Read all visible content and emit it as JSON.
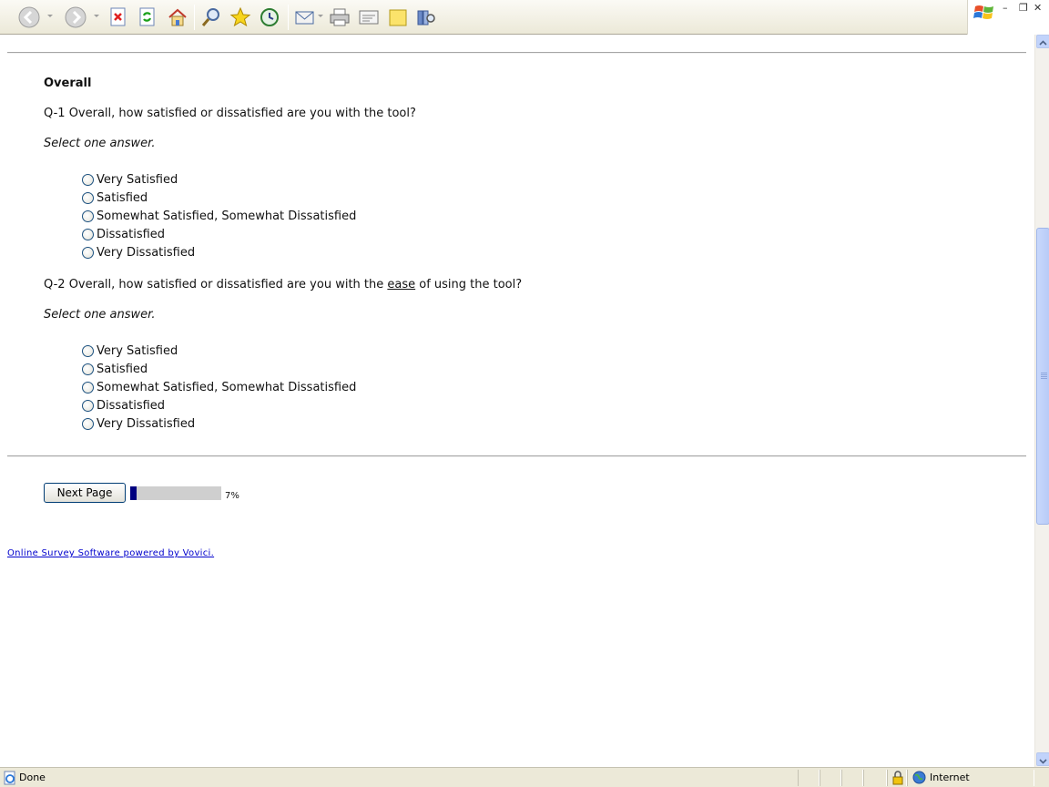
{
  "toolbar": {
    "icons": [
      "back-icon",
      "forward-icon",
      "stop-icon",
      "refresh-icon",
      "home-icon",
      "search-icon",
      "favorites-icon",
      "history-icon",
      "mail-icon",
      "print-icon",
      "edit-icon",
      "discuss-icon",
      "research-icon"
    ]
  },
  "survey": {
    "section_title": "Overall",
    "questions": [
      {
        "prompt_before": "Q-1 Overall, how satisfied or dissatisfied are you with the tool?",
        "instruction": "Select one answer.",
        "options": [
          "Very Satisfied",
          "Satisfied",
          "Somewhat Satisfied, Somewhat Dissatisfied",
          "Dissatisfied",
          "Very Dissatisfied"
        ]
      },
      {
        "prompt_before": "Q-2 Overall, how satisfied or dissatisfied are you with the ",
        "prompt_underline": "ease",
        "prompt_after": " of using the tool?",
        "instruction": "Select one answer.",
        "options": [
          "Very Satisfied",
          "Satisfied",
          "Somewhat Satisfied, Somewhat Dissatisfied",
          "Dissatisfied",
          "Very Dissatisfied"
        ]
      }
    ],
    "next_button": "Next Page",
    "progress_percent": 7,
    "progress_label": "7%",
    "footer_link": "Online Survey Software powered by Vovici."
  },
  "statusbar": {
    "status_text": "Done",
    "zone_text": "Internet"
  },
  "colors": {
    "progress_fill": "#00007f",
    "progress_track": "#cfcfcf",
    "link": "#0000cc"
  }
}
